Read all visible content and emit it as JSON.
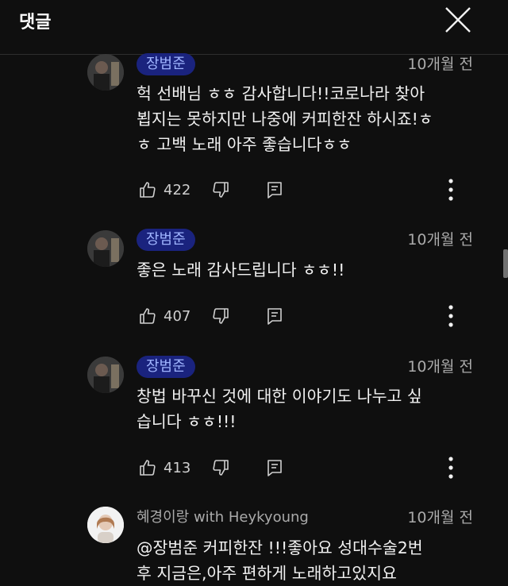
{
  "header": {
    "title": "댓글",
    "close_icon": "close-icon"
  },
  "comments": [
    {
      "author": "장범준",
      "time": "10개월 전",
      "text": "헉 선배님 ㅎㅎ 감사합니다!!코로나라 찾아\n뵙지는 못하지만 나중에 커피한잔 하시죠!ㅎ\nㅎ  고백 노래 아주 좋습니다ㅎㅎ",
      "likes": "422"
    },
    {
      "author": "장범준",
      "time": "10개월 전",
      "text": "좋은 노래 감사드립니다 ㅎㅎ!!",
      "likes": "407"
    },
    {
      "author": "장범준",
      "time": "10개월 전",
      "text": "창법 바꾸신 것에 대한 이야기도 나누고 싶\n습니다 ㅎㅎ!!!",
      "likes": "413"
    },
    {
      "author": "혜경이랑 with Heykyoung",
      "time": "10개월 전",
      "text": " @장범준  커피한잔 !!!좋아요  성대수술2번\n후 지금은,아주 편하게 노래하고있지요"
    }
  ]
}
